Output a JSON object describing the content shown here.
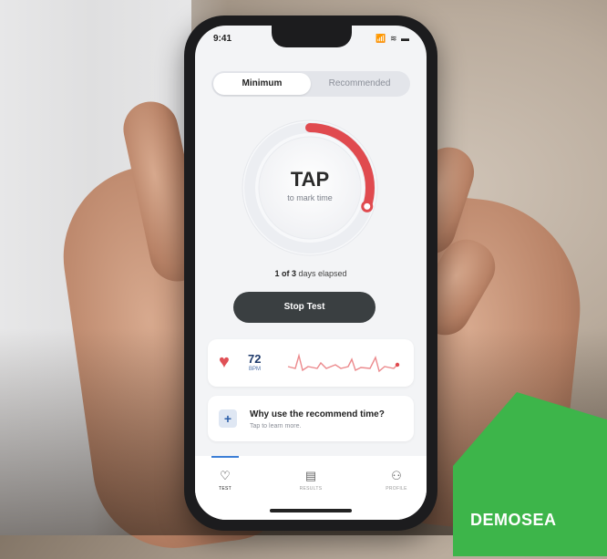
{
  "status_bar": {
    "time": "9:41",
    "icons": "📶 ≋ ▬"
  },
  "segmented_control": {
    "options": [
      "Minimum",
      "Recommended"
    ],
    "selected": "Minimum"
  },
  "dial": {
    "title": "TAP",
    "subtitle": "to mark time",
    "progress_fraction": 0.3,
    "progress_color": "#e04a4f"
  },
  "elapsed": {
    "current": "1",
    "of_word": "of",
    "total": "3",
    "suffix": "days elapsed"
  },
  "stop_button": {
    "label": "Stop Test"
  },
  "heart_rate": {
    "value": "72",
    "unit": "BPM",
    "icon": "heart-icon"
  },
  "info_card": {
    "title": "Why use the recommend time?",
    "subtitle": "Tap to learn more."
  },
  "tab_bar": {
    "tabs": [
      {
        "label": "TEST",
        "icon": "heart-outline-icon"
      },
      {
        "label": "RESULTS",
        "icon": "clipboard-icon"
      },
      {
        "label": "PROFILE",
        "icon": "person-icon"
      }
    ],
    "active": "TEST"
  },
  "watermark": {
    "text": "DEMOSEA"
  },
  "colors": {
    "accent_red": "#e04a4f",
    "button_dark": "#3a3f41",
    "watermark_green": "#3db54a"
  }
}
